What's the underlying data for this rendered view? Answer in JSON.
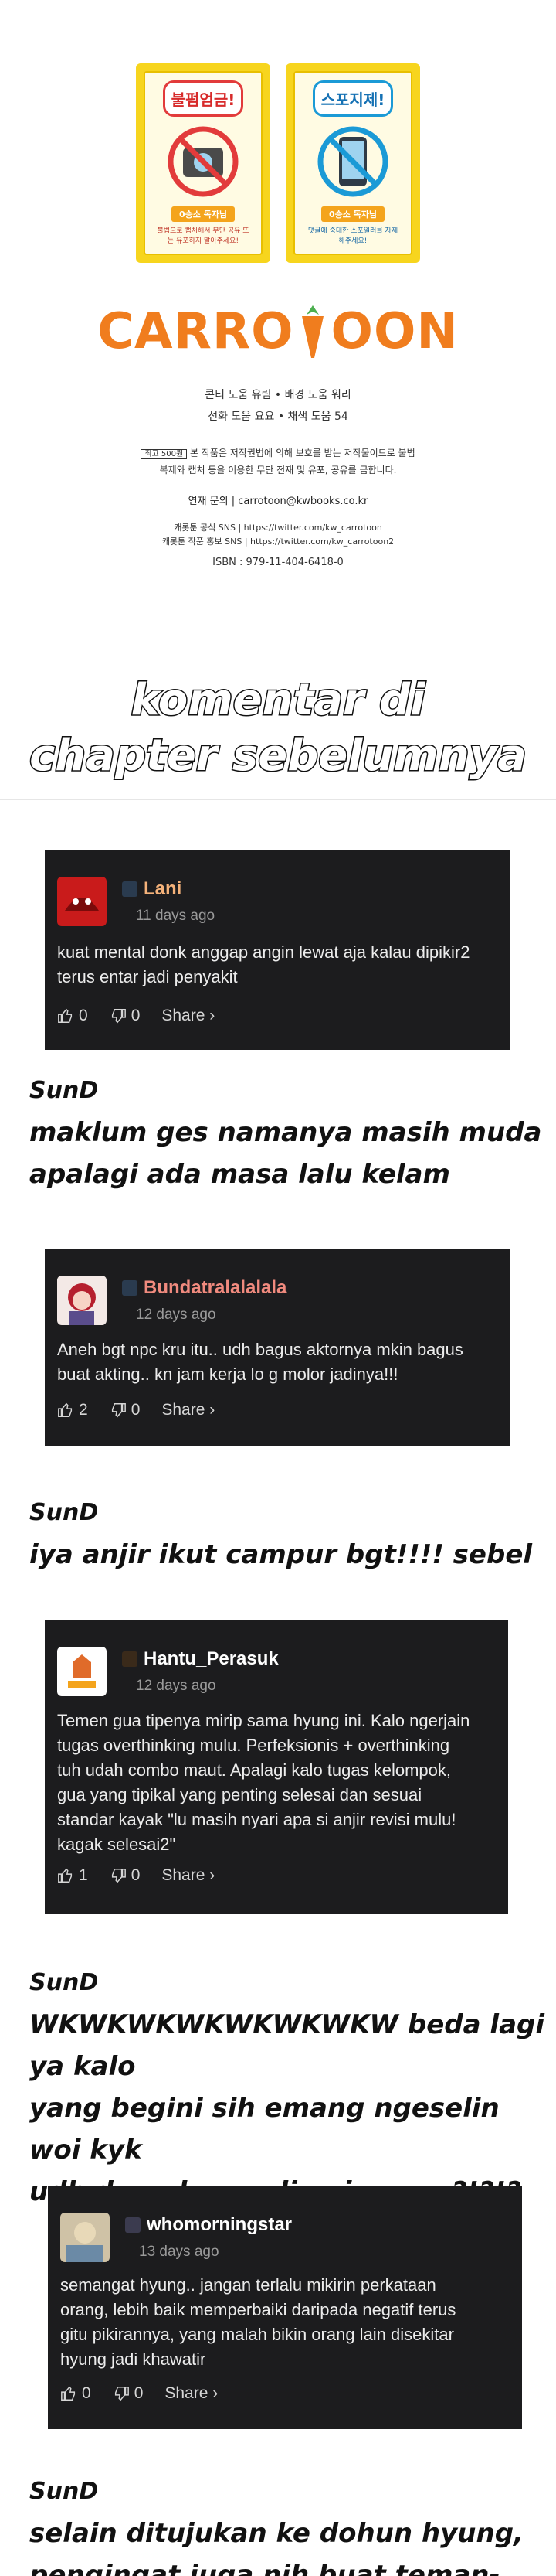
{
  "colophon": {
    "poster1_title": "불펌엄금!",
    "poster1_tag": "0승소 독자님",
    "poster1_text": "불법으로 캡처해서 무단 공유 또는 유포하지 말아주세요!",
    "poster2_title": "스포지제!",
    "poster2_tag": "0승소 독자님",
    "poster2_text": "댓글에 중대한 스포일러를 자제해주세요!",
    "logo_text_left": "CARRO",
    "logo_text_right": "OON",
    "credit_line1": "콘티 도움 유림 • 배경 도움 워리",
    "credit_line2": "선화 도움 요요 • 채색 도움 54",
    "notice_tag": "최고 500원",
    "notice_text": "본 작품은 저작권법에 의해 보호를 받는 저작물이므로 불법 복제와 캡처 등을 이용한 무단 전재 및 유포, 공유를 금합니다.",
    "contact": "연재 문의 | carrotoon@kwbooks.co.kr",
    "sns_line1": "캐롯툰 공식 SNS | https://twitter.com/kw_carrotoon",
    "sns_line2": "캐롯툰 작품 홍보 SNS | https://twitter.com/kw_carrotoon2",
    "isbn": "ISBN : 979-11-404-6418-0"
  },
  "heading": {
    "line1": "komentar di",
    "line2": "chapter sebelumnya"
  },
  "comments": [
    {
      "name": "Lani",
      "time": "11 days ago",
      "text_lines": [
        "kuat mental donk anggap angin lewat aja kalau dipikir2",
        "terus entar jadi penyakit"
      ],
      "likes": "0",
      "dislikes": "0",
      "share": "Share ›",
      "name_color": "#f5b27a"
    },
    {
      "name": "Bundatralalalala",
      "time": "12 days ago",
      "text_lines": [
        "Aneh bgt npc kru itu.. udh bagus aktornya mkin bagus",
        "buat akting.. kn jam kerja lo g molor jadinya!!!"
      ],
      "likes": "2",
      "dislikes": "0",
      "share": "Share ›",
      "name_color": "#f08a7e"
    },
    {
      "name": "Hantu_Perasuk",
      "time": "12 days ago",
      "text_lines": [
        "Temen gua tipenya mirip sama hyung ini. Kalo ngerjain",
        "tugas overthinking mulu. Perfeksionis + overthinking",
        "tuh udah combo maut. Apalagi kalo tugas kelompok,",
        "gua yang tipikal yang penting selesai dan sesuai",
        "standar kayak \"lu masih nyari apa si anjir revisi mulu!",
        "kagak selesai2\""
      ],
      "likes": "1",
      "dislikes": "0",
      "share": "Share ›",
      "name_color": "#ffffff"
    },
    {
      "name": "whomorningstar",
      "time": "13 days ago",
      "text_lines": [
        "semangat hyung.. jangan terlalu mikirin perkataan",
        "orang, lebih baik memperbaiki daripada negatif terus",
        "gitu pikirannya, yang malah bikin orang lain disekitar",
        "hyung jadi khawatir"
      ],
      "likes": "0",
      "dislikes": "0",
      "share": "Share ›",
      "name_color": "#ffffff"
    }
  ],
  "replies": [
    {
      "name": "SunD",
      "lines": [
        "maklum ges namanya masih muda",
        "apalagi ada masa lalu kelam"
      ]
    },
    {
      "name": "SunD",
      "lines": [
        "iya anjir ikut campur bgt!!!! sebel"
      ]
    },
    {
      "name": "SunD",
      "lines": [
        "WKWKWKWKWKWKWKW beda lagi ya kalo",
        "yang begini sih emang ngeselin woi kyk",
        "udh dong kumpulin aja napa?!?!?"
      ]
    },
    {
      "name": "SunD",
      "lines": [
        "selain ditujukan ke dohun hyung,",
        "pengingat juga nih buat teman-teman"
      ]
    }
  ]
}
